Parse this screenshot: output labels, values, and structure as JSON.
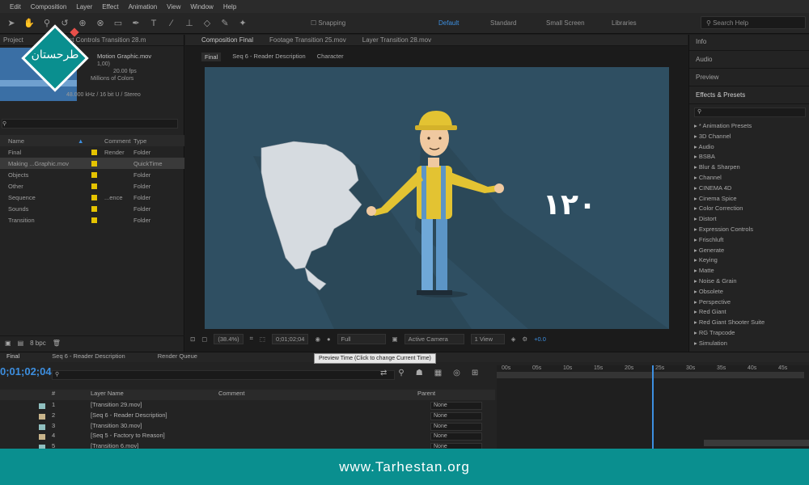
{
  "menu": [
    "Edit",
    "Composition",
    "Layer",
    "Effect",
    "Animation",
    "View",
    "Window",
    "Help"
  ],
  "toolbar": {
    "snapping": "Snapping",
    "workspaces": [
      "Default",
      "Standard",
      "Small Screen",
      "Libraries"
    ],
    "search_help": "Search Help"
  },
  "project": {
    "tab": "Project",
    "effect_controls_tab": "Effect Controls Transition 28.m",
    "preview_title": "Motion Graphic.mov",
    "preview_lines": [
      "1,00)",
      "20.00 fps",
      "Millions of Colors",
      "48.000 kHz / 16 bit U / Stereo"
    ],
    "columns": {
      "name": "Name",
      "comment": "Comment",
      "type": "Type"
    },
    "items": [
      {
        "name": "Final",
        "comment": "Render",
        "type": "Folder"
      },
      {
        "name": "Making ...Graphic.mov",
        "comment": "",
        "type": "QuickTime"
      },
      {
        "name": "Objects",
        "comment": "",
        "type": "Folder"
      },
      {
        "name": "Other",
        "comment": "",
        "type": "Folder"
      },
      {
        "name": "Sequence",
        "comment": "...ence",
        "type": "Folder"
      },
      {
        "name": "Sounds",
        "comment": "",
        "type": "Folder"
      },
      {
        "name": "Transition",
        "comment": "",
        "type": "Folder"
      }
    ],
    "bpc": "8 bpc"
  },
  "comp": {
    "tabs": [
      "Composition Final",
      "Footage Transition 25.mov",
      "Layer Transition 28.mov"
    ],
    "breadcrumbs": [
      "Final",
      "Seq 6 - Reader Description",
      "Character"
    ],
    "overlay_text": "١٢٠",
    "viewer": {
      "zoom": "(38.4%)",
      "timecode": "0;01;02;04",
      "resolution": "Full",
      "camera": "Active Camera",
      "views": "1 View",
      "exposure": "+0.0"
    }
  },
  "effects": {
    "panels": [
      "Info",
      "Audio",
      "Preview",
      "Effects & Presets"
    ],
    "categories": [
      "* Animation Presets",
      "3D Channel",
      "Audio",
      "BSBA",
      "Blur & Sharpen",
      "Channel",
      "CINEMA 4D",
      "Cinema Spice",
      "Color Correction",
      "Distort",
      "Expression Controls",
      "Frischluft",
      "Generate",
      "Keying",
      "Matte",
      "Noise & Grain",
      "Obsolete",
      "Perspective",
      "Red Giant",
      "Red Giant Shooter Suite",
      "RG Trapcode",
      "Simulation"
    ]
  },
  "timeline": {
    "tabs": [
      "Final",
      "Seq 6 - Reader Description",
      "Render Queue"
    ],
    "timecode": "0;01;02;04",
    "tooltip": "Preview Time (Click to change Current Time)",
    "columns": {
      "layer_name": "Layer Name",
      "comment": "Comment",
      "parent": "Parent"
    },
    "layers": [
      {
        "index": "1",
        "name": "[Transition 29.mov]",
        "parent": "None",
        "color": "#8fbfbf"
      },
      {
        "index": "2",
        "name": "[Seq 6 - Reader Description]",
        "parent": "None",
        "color": "#c8b48a"
      },
      {
        "index": "3",
        "name": "[Transition 30.mov]",
        "parent": "None",
        "color": "#8fbfbf"
      },
      {
        "index": "4",
        "name": "[Seq 5 - Factory to Reason]",
        "parent": "None",
        "color": "#c8b48a"
      },
      {
        "index": "5",
        "name": "[Transition 6.mov]",
        "parent": "None",
        "color": "#8fbfbf"
      }
    ],
    "ruler": [
      "00s",
      "05s",
      "10s",
      "15s",
      "20s",
      "25s",
      "30s",
      "35s",
      "40s",
      "45s"
    ]
  },
  "footer": {
    "url": "www.Tarhestan.org"
  },
  "logo": {
    "text": "طرحستان"
  },
  "colors": {
    "accent": "#3d8fe0",
    "footer": "#0a8f8f",
    "stage": "#2f4f62"
  }
}
